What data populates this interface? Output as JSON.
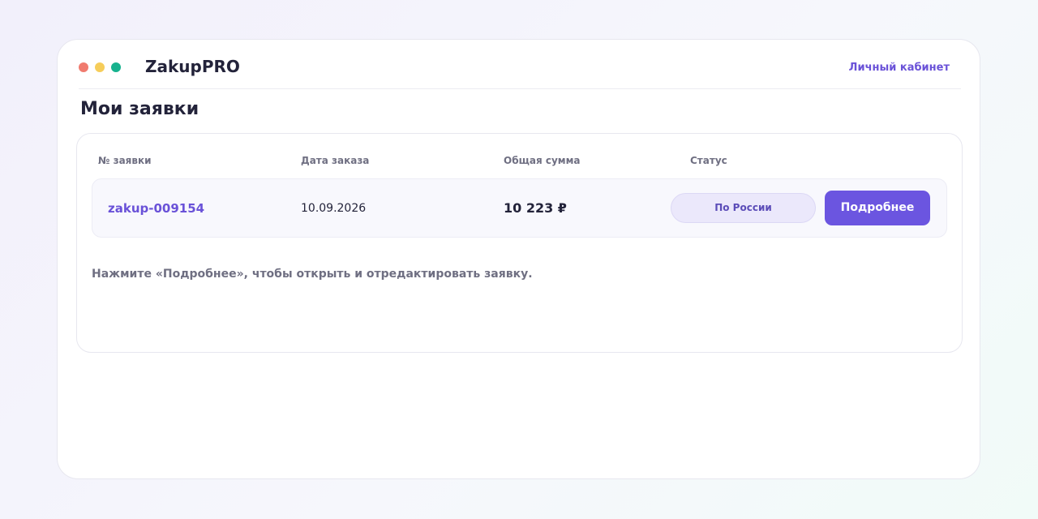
{
  "app": {
    "title": "ZakupPRO",
    "account_link": "Личный кабинет"
  },
  "page": {
    "title": "Мои заявки",
    "hint": "Нажмите «Подробнее», чтобы открыть и отредактировать заявку."
  },
  "table": {
    "headers": [
      "№ заявки",
      "Дата заказа",
      "Общая сумма",
      "Статус"
    ],
    "rows": [
      {
        "id": "zakup-009154",
        "date": "10.09.2026",
        "sum": "10 223 ₽",
        "status": "По России",
        "action": "Подробнее"
      }
    ]
  },
  "window_controls": {
    "close_color": "#f07b6f",
    "minimize_color": "#f6cd5a",
    "maximize_color": "#17b28e"
  },
  "colors": {
    "accent": "#6b55e0",
    "link": "#6a52d8"
  }
}
